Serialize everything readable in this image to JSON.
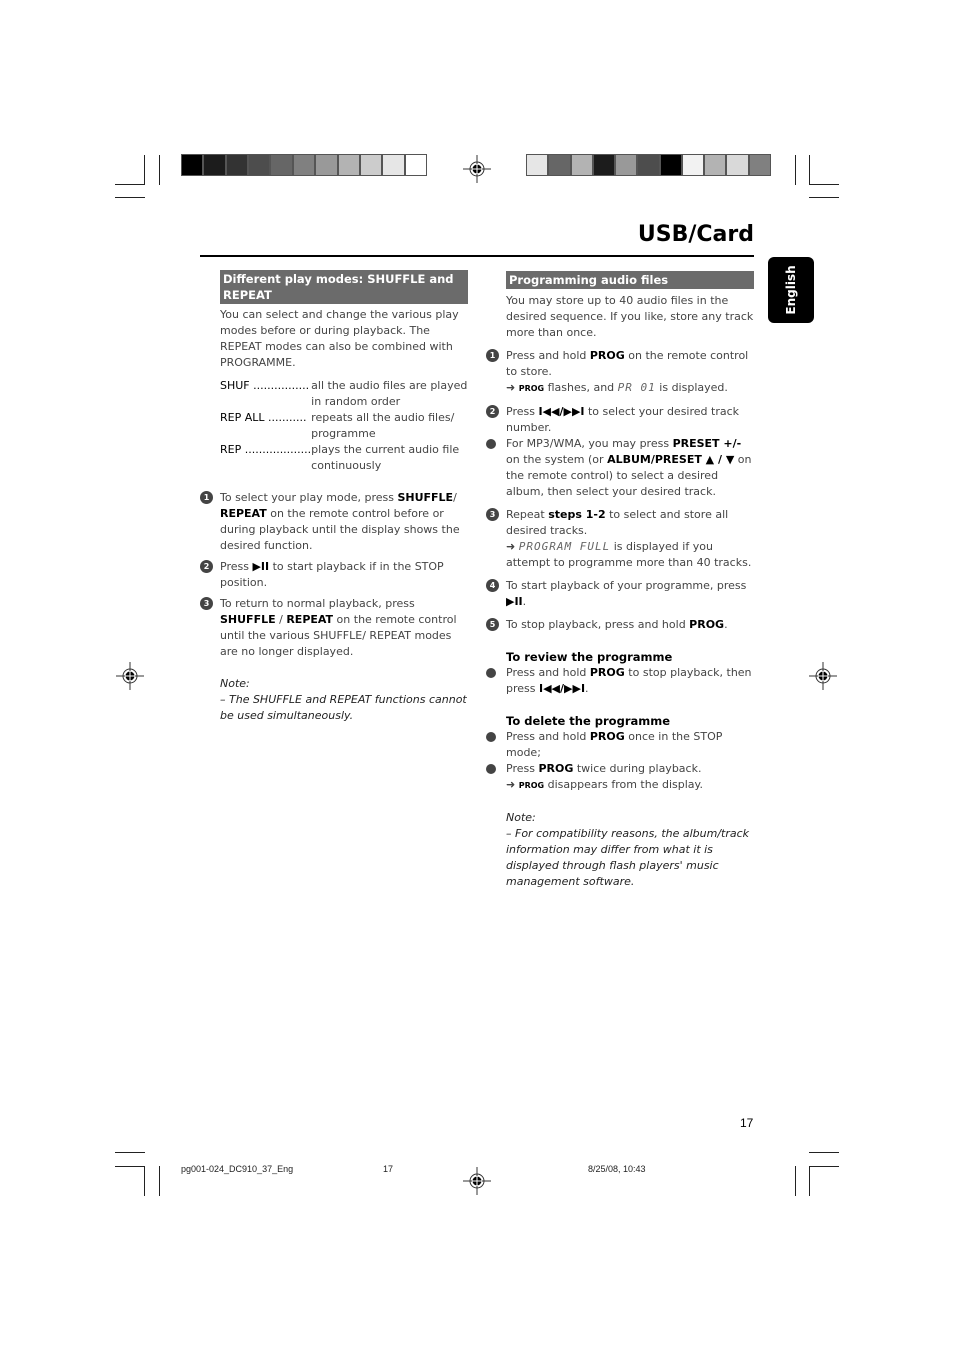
{
  "page": {
    "section_title": "USB/Card",
    "language_tab": "English",
    "page_number": "17"
  },
  "left": {
    "heading": "Different play modes: SHUFFLE and REPEAT",
    "intro": "You can select and change the various play modes before or during playback. The REPEAT modes can also be combined with PROGRAMME.",
    "modes": [
      {
        "key": "SHUF ................",
        "desc": "all the audio files are played in random order"
      },
      {
        "key": "REP ALL ...........",
        "desc": "repeats all the audio files/ programme"
      },
      {
        "key": "REP ...................",
        "desc": "plays the current audio file continuously"
      }
    ],
    "steps": [
      {
        "num": "1",
        "pre": "To select your play mode, press ",
        "bold1": "SHUFFLE",
        "mid": "/ ",
        "bold2": "REPEAT",
        "post": " on the remote control before or during playback until the display shows the desired function."
      },
      {
        "num": "2",
        "pre": "Press ",
        "bold1": "▶II",
        "post": " to start playback if in the STOP position."
      },
      {
        "num": "3",
        "pre": "To return to normal playback, press ",
        "bold1": "SHUFFLE",
        "mid": " / ",
        "bold2": "REPEAT",
        "post": " on the remote control until the various SHUFFLE/ REPEAT modes are no longer displayed."
      }
    ],
    "note_label": "Note:",
    "note_text": "– The SHUFFLE and REPEAT functions cannot be used simultaneously."
  },
  "right": {
    "heading": "Programming audio files",
    "intro": "You may store up to 40 audio files in the desired sequence. If you like, store any track more than once.",
    "step1": {
      "num": "1",
      "pre": "Press and hold ",
      "bold": "PROG",
      "post": " on the remote control to store.",
      "arrow": "➜",
      "prog": "PROG",
      "flash": " flashes, and ",
      "lcd": "PR 01",
      "tail": " is displayed."
    },
    "step2": {
      "num": "2",
      "pre": "Press ",
      "bold": "I◀◀/▶▶I",
      "post": " to select your desired track number."
    },
    "bullet_mp3": {
      "pre": "For MP3/WMA, you may press ",
      "bold1": "PRESET +/-",
      "mid": " on the system (or ",
      "bold2": "ALBUM/PRESET ▲ / ▼",
      "post": " on the remote control) to select a desired album, then select your desired track."
    },
    "step3": {
      "num": "3",
      "pre": "Repeat ",
      "bold": "steps 1-2",
      "post": " to select and store all desired tracks.",
      "arrow": "➜",
      "lcd": "PROGRAM FULL",
      "tail": " is displayed if you attempt to programme more than 40 tracks."
    },
    "step4": {
      "num": "4",
      "pre": "To start playback of your programme, press ",
      "bold": "▶II",
      "post": "."
    },
    "step5": {
      "num": "5",
      "pre": "To stop playback, press and hold ",
      "bold": "PROG",
      "post": "."
    },
    "review_heading": "To review the programme",
    "review_bullet": {
      "pre": "Press and hold ",
      "bold": "PROG",
      "post": " to stop playback, then press ",
      "bold2": "I◀◀/▶▶I",
      "tail": "."
    },
    "delete_heading": "To delete the programme",
    "delete_bullets": [
      {
        "pre": "Press and hold ",
        "bold": "PROG",
        "post": " once in the STOP mode;"
      },
      {
        "pre": "Press ",
        "bold": "PROG",
        "post": " twice during playback."
      }
    ],
    "delete_result": {
      "arrow": "➜",
      "prog": "PROG",
      "post": " disappears from the display."
    },
    "note_label": "Note:",
    "note_text": "– For compatibility reasons, the album/track information may differ from what it is displayed through flash players' music management software."
  },
  "footer": {
    "file": "pg001-024_DC910_37_Eng",
    "page": "17",
    "date": "8/25/08, 10:43"
  },
  "print_marks": {
    "left_bar_grays": [
      "#000000",
      "#1c1c1c",
      "#333333",
      "#4d4d4d",
      "#666666",
      "#808080",
      "#999999",
      "#b3b3b3",
      "#cccccc",
      "#e6e6e6",
      "#ffffff"
    ],
    "right_bar_grays": [
      "#e6e6e6",
      "#666666",
      "#b3b3b3",
      "#1c1c1c",
      "#999999",
      "#4d4d4d",
      "#000000",
      "#f2f2f2",
      "#b3b3b3",
      "#d9d9d9",
      "#808080"
    ]
  }
}
